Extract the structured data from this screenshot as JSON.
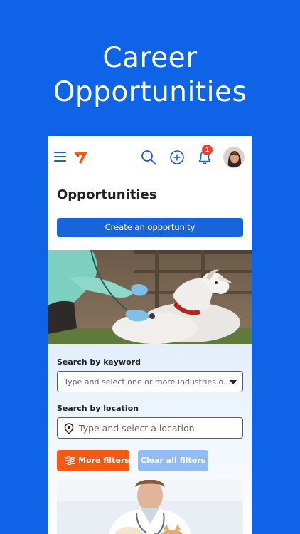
{
  "promo": {
    "line1": "Career",
    "line2": "Opportunities"
  },
  "header": {
    "notification_count": "1",
    "icons": [
      "hamburger-menu-icon",
      "brand-logo-icon",
      "search-icon",
      "add-circle-icon",
      "bell-icon",
      "user-avatar"
    ]
  },
  "page": {
    "title": "Opportunities",
    "create_button": "Create an opportunity"
  },
  "search": {
    "keyword_label": "Search by keyword",
    "keyword_placeholder": "Type and select one or more industries o...",
    "location_label": "Search by location",
    "location_placeholder": "Type and select a location"
  },
  "filters": {
    "more_label": "More filters",
    "clear_label": "Clear all filters"
  },
  "colors": {
    "brand_blue": "#0f63e6",
    "button_blue": "#1765d8",
    "accent_orange": "#f45a16",
    "disabled_blue": "#93bdf2",
    "badge_red": "#e4412f"
  }
}
